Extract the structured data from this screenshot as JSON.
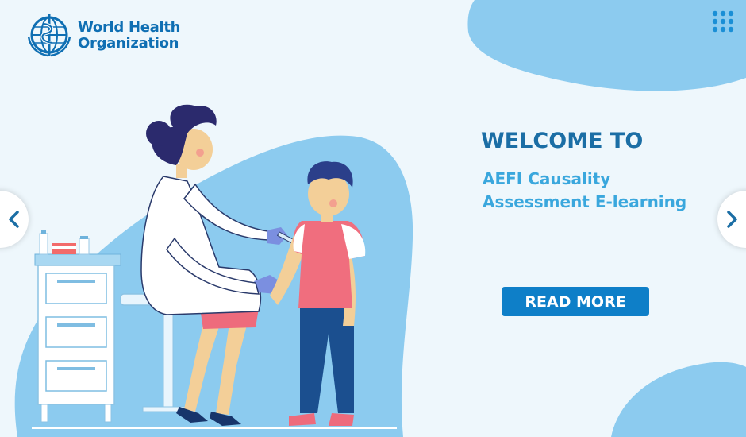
{
  "brand": {
    "name_line1": "World Health",
    "name_line2": "Organization",
    "color": "#0f6fb3"
  },
  "header": {
    "menu_icon": "grid-menu-icon"
  },
  "hero": {
    "heading": "WELCOME TO",
    "subtitle_line1": "AEFI Causality",
    "subtitle_line2": "Assessment E-learning",
    "cta_label": "READ MORE",
    "illustration": "nurse-vaccinating-child-illustration"
  },
  "carousel": {
    "prev_icon": "chevron-left-icon",
    "next_icon": "chevron-right-icon"
  },
  "colors": {
    "background": "#eef7fc",
    "blob": "#8ccbef",
    "heading": "#1b6ea5",
    "subtitle": "#3aa7dd",
    "button": "#0e7fc8"
  }
}
